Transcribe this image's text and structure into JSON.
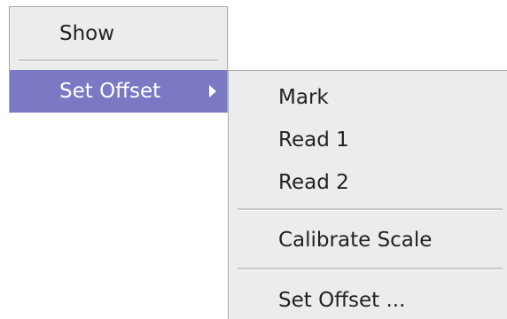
{
  "main_menu": {
    "items": [
      {
        "label": "Show"
      },
      {
        "label": "Set Offset",
        "selected": true,
        "has_submenu": true
      }
    ]
  },
  "sub_menu": {
    "items": [
      {
        "label": "Mark"
      },
      {
        "label": "Read 1"
      },
      {
        "label": "Read 2"
      },
      {
        "label": "Calibrate Scale"
      },
      {
        "label": "Set Offset ..."
      }
    ]
  },
  "colors": {
    "menu_background": "#ececec",
    "selection": "#7b79c4",
    "text": "#222222"
  },
  "icons": {
    "submenu_indicator": "caret-right-icon"
  }
}
